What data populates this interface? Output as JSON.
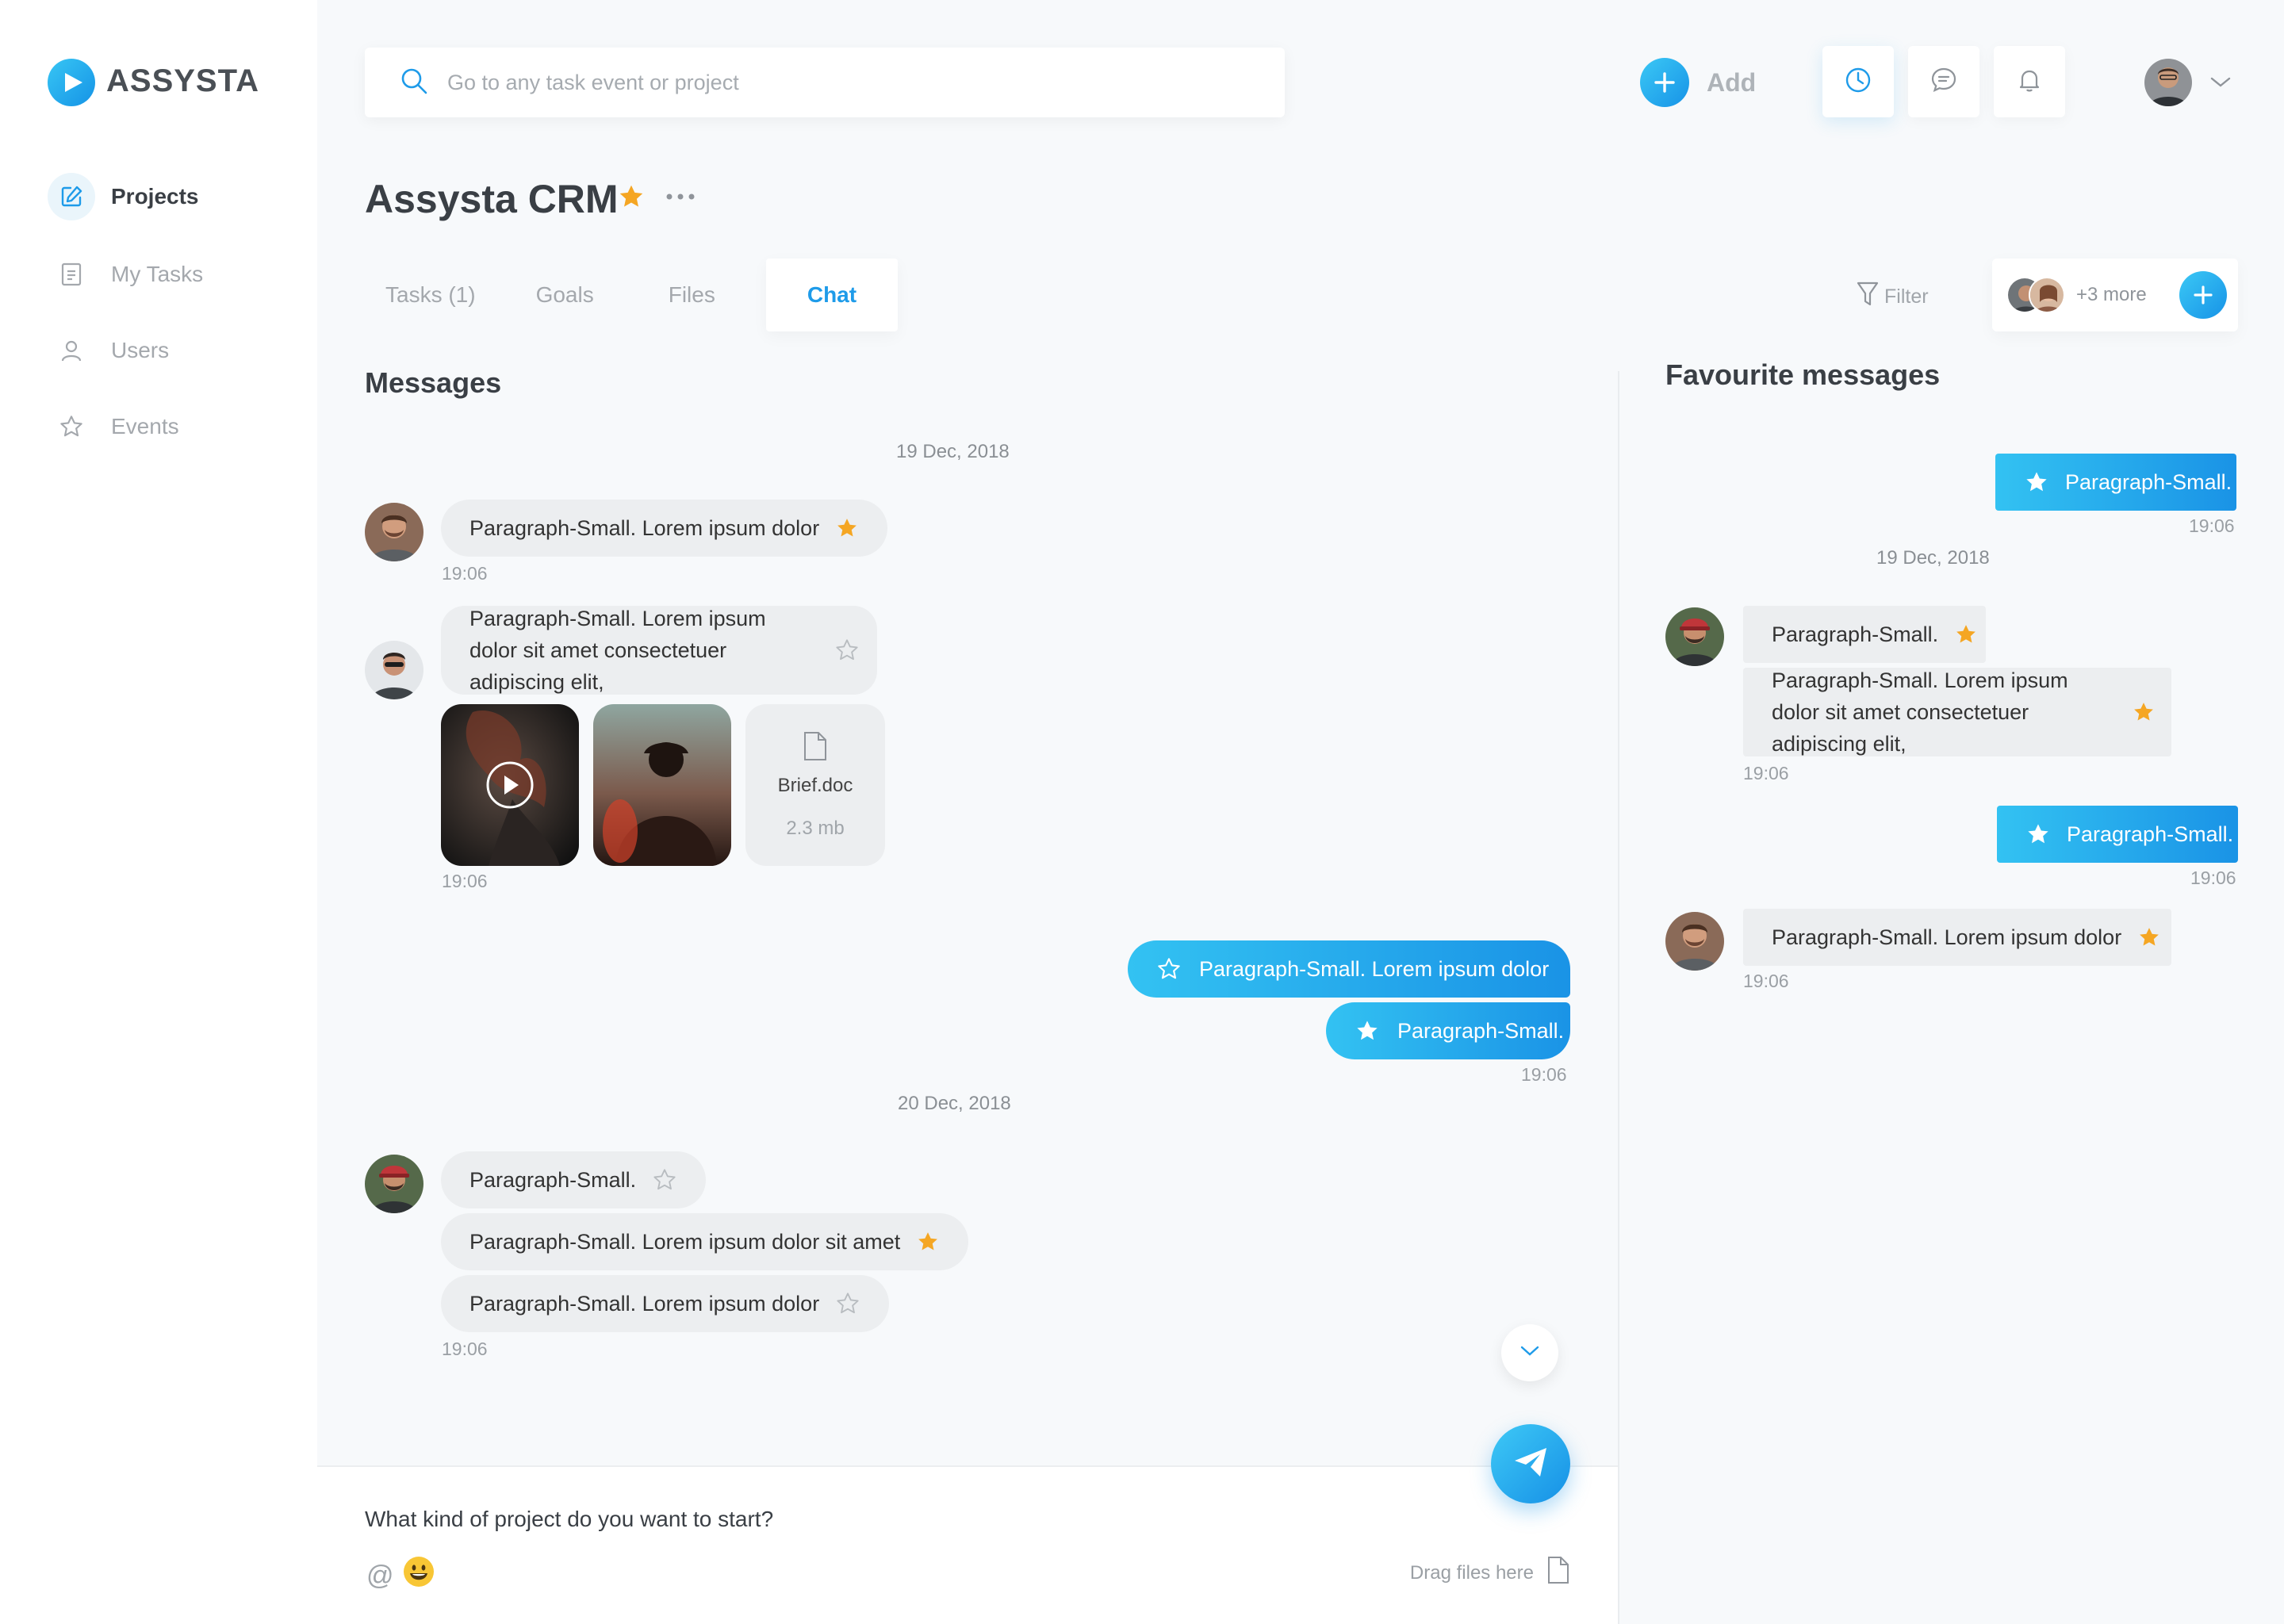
{
  "brand": {
    "name": "ASSYSTA"
  },
  "sidebar": {
    "items": [
      {
        "label": "Projects",
        "icon": "edit-icon",
        "active": true
      },
      {
        "label": "My Tasks",
        "icon": "document-icon",
        "active": false
      },
      {
        "label": "Users",
        "icon": "user-icon",
        "active": false
      },
      {
        "label": "Events",
        "icon": "star-icon",
        "active": false
      }
    ]
  },
  "topbar": {
    "search_placeholder": "Go to any task event or project",
    "add_label": "Add",
    "icons": [
      "clock-icon",
      "chat-icon",
      "bell-icon"
    ]
  },
  "project": {
    "title": "Assysta CRM",
    "tabs": [
      {
        "label": "Tasks (1)",
        "active": false
      },
      {
        "label": "Goals",
        "active": false
      },
      {
        "label": "Files",
        "active": false
      },
      {
        "label": "Chat",
        "active": true
      }
    ],
    "filter_label": "Filter",
    "members_more": "+3 more"
  },
  "colors": {
    "accent": "#1e9be9",
    "accent_gradient_start": "#33c2f2",
    "accent_gradient_end": "#1a93e6",
    "star_gold": "#f5a623",
    "bubble_gray": "#eceef0"
  },
  "chat": {
    "title": "Messages",
    "date1": "19 Dec, 2018",
    "date2": "20 Dec, 2018",
    "m1": {
      "text": "Paragraph-Small. Lorem ipsum dolor",
      "starred": true,
      "time": "19:06"
    },
    "m2": {
      "text": "Paragraph-Small. Lorem ipsum dolor sit amet consectetuer adipiscing elit,",
      "starred": false
    },
    "file": {
      "name": "Brief.doc",
      "size": "2.3 mb"
    },
    "m2_time": "19:06",
    "s1": {
      "text": "Paragraph-Small. Lorem ipsum dolor",
      "starred": false
    },
    "s2": {
      "text": "Paragraph-Small.",
      "starred": true
    },
    "s_time": "19:06",
    "g1": {
      "text": "Paragraph-Small.",
      "starred": false
    },
    "g2": {
      "text": "Paragraph-Small. Lorem ipsum dolor sit amet",
      "starred": true
    },
    "g3": {
      "text": "Paragraph-Small. Lorem ipsum dolor",
      "starred": false
    },
    "g_time": "19:06"
  },
  "composer": {
    "prompt": "What kind of project do you want to start?",
    "at_symbol": "@",
    "drag_label": "Drag files here"
  },
  "favourites": {
    "title": "Favourite messages",
    "f1": {
      "text": "Paragraph-Small.",
      "time": "19:06"
    },
    "date": "19 Dec, 2018",
    "f2": {
      "text": "Paragraph-Small."
    },
    "f3": {
      "text": "Paragraph-Small. Lorem ipsum dolor sit amet consectetuer adipiscing elit,"
    },
    "f23_time": "19:06",
    "f4": {
      "text": "Paragraph-Small.",
      "time": "19:06"
    },
    "f5": {
      "text": "Paragraph-Small. Lorem ipsum dolor",
      "time": "19:06"
    }
  }
}
